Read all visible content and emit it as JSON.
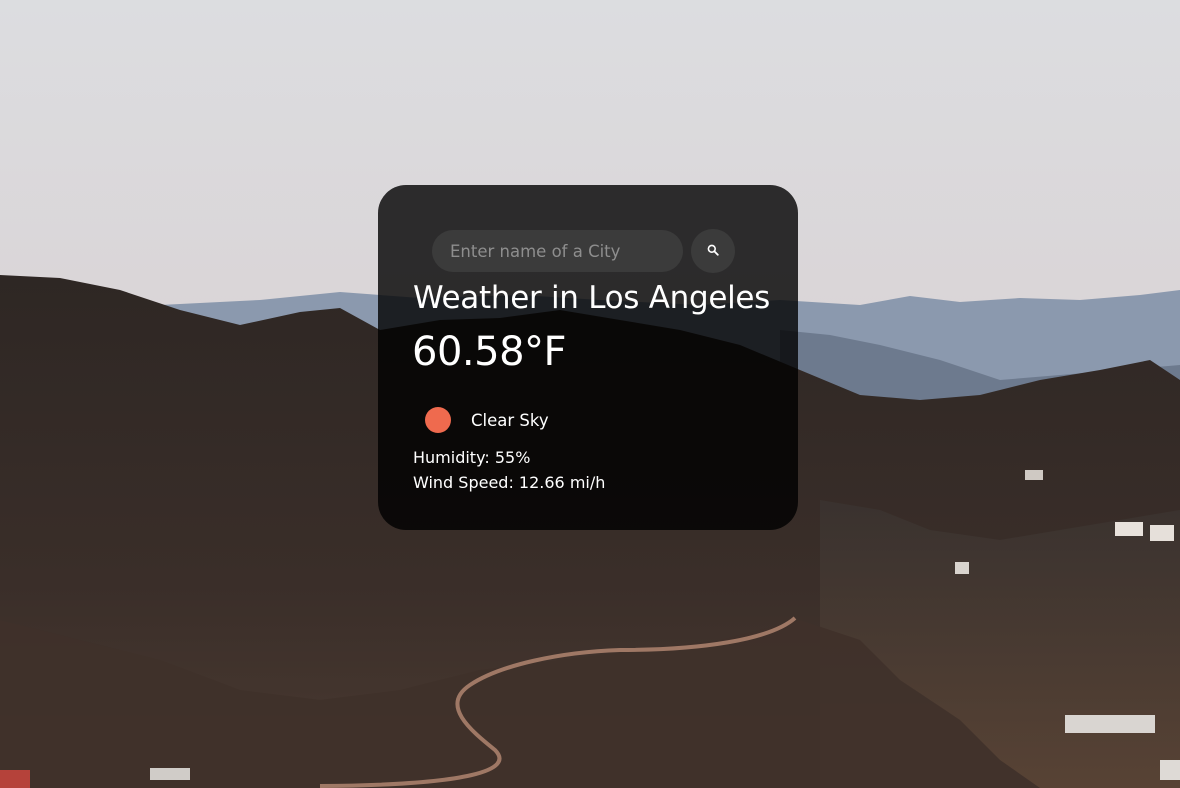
{
  "search": {
    "placeholder": "Enter name of a City",
    "value": "",
    "button_icon": "search-icon"
  },
  "weather": {
    "title": "Weather in Los Angeles",
    "temperature": "60.58°F",
    "condition": "Clear Sky",
    "condition_icon": "sun-icon",
    "humidity": "Humidity: 55%",
    "wind": "Wind Speed: 12.66 mi/h"
  },
  "background": {
    "description_icon": "landscape-photo"
  },
  "colors": {
    "card_background": "rgba(0,0,0,0.80)",
    "input_background": "#3b3b3b",
    "sun": "#ef6a4e",
    "text": "#ffffff",
    "placeholder": "#8e8e8e"
  }
}
